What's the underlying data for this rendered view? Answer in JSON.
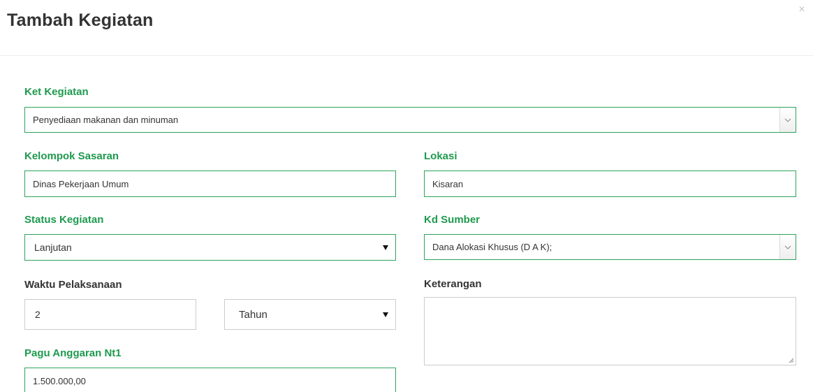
{
  "modal": {
    "title": "Tambah Kegiatan",
    "close_glyph": "×"
  },
  "form": {
    "ket_kegiatan": {
      "label": "Ket Kegiatan",
      "value": "Penyediaan makanan dan minuman"
    },
    "kelompok_sasaran": {
      "label": "Kelompok Sasaran",
      "value": "Dinas Pekerjaan Umum"
    },
    "lokasi": {
      "label": "Lokasi",
      "value": "Kisaran"
    },
    "status_kegiatan": {
      "label": "Status Kegiatan",
      "value": "Lanjutan"
    },
    "kd_sumber": {
      "label": "Kd Sumber",
      "value": "Dana Alokasi Khusus (D A K);"
    },
    "waktu_pelaksanaan": {
      "label": "Waktu Pelaksanaan",
      "value": "2",
      "unit": "Tahun"
    },
    "keterangan": {
      "label": "Keterangan",
      "value": ""
    },
    "pagu_anggaran_nt1": {
      "label": "Pagu Anggaran Nt1",
      "value": "1.500.000,00"
    }
  },
  "colors": {
    "accent": "#1e9a4e",
    "border_active": "#2ea35b",
    "border_default": "#cccccc"
  },
  "icons": [
    "close-icon",
    "chevron-down-icon",
    "caret-down-icon",
    "resize-grip-icon"
  ]
}
